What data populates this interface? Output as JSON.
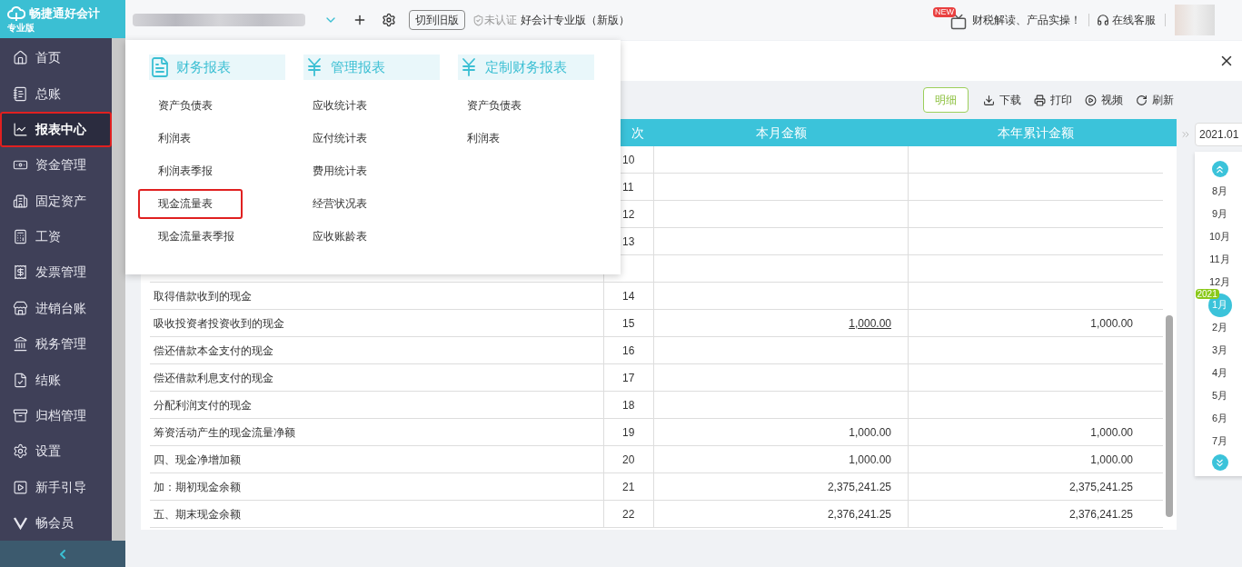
{
  "logo": {
    "name": "畅捷通好会计",
    "edition": "专业版"
  },
  "topbar": {
    "switch_button": "切到旧版",
    "cert_status": "未认证",
    "product": "好会计专业版（新版）",
    "promo_badge": "NEW",
    "promo": "财税解读、产品实操！",
    "support": "在线客服"
  },
  "sidebar": {
    "items": [
      {
        "label": "首页",
        "selected": false,
        "highlighted": false
      },
      {
        "label": "总账",
        "selected": false,
        "highlighted": false
      },
      {
        "label": "报表中心",
        "selected": true,
        "highlighted": true
      },
      {
        "label": "资金管理",
        "selected": false,
        "highlighted": false
      },
      {
        "label": "固定资产",
        "selected": false,
        "highlighted": false
      },
      {
        "label": "工资",
        "selected": false,
        "highlighted": false
      },
      {
        "label": "发票管理",
        "selected": false,
        "highlighted": false
      },
      {
        "label": "进销台账",
        "selected": false,
        "highlighted": false
      },
      {
        "label": "税务管理",
        "selected": false,
        "highlighted": false
      },
      {
        "label": "结账",
        "selected": false,
        "highlighted": false
      },
      {
        "label": "归档管理",
        "selected": false,
        "highlighted": false
      },
      {
        "label": "设置",
        "selected": false,
        "highlighted": false
      },
      {
        "label": "新手引导",
        "selected": false,
        "highlighted": false
      },
      {
        "label": "畅会员",
        "selected": false,
        "highlighted": false
      }
    ]
  },
  "menu": {
    "groups": [
      {
        "title": "财务报表",
        "items": [
          {
            "label": "资产负债表",
            "highlighted": false
          },
          {
            "label": "利润表",
            "highlighted": false
          },
          {
            "label": "利润表季报",
            "highlighted": false
          },
          {
            "label": "现金流量表",
            "highlighted": true
          },
          {
            "label": "现金流量表季报",
            "highlighted": false
          }
        ]
      },
      {
        "title": "管理报表",
        "items": [
          {
            "label": "应收统计表",
            "highlighted": false
          },
          {
            "label": "应付统计表",
            "highlighted": false
          },
          {
            "label": "费用统计表",
            "highlighted": false
          },
          {
            "label": "经营状况表",
            "highlighted": false
          },
          {
            "label": "应收账龄表",
            "highlighted": false
          }
        ]
      },
      {
        "title": "定制财务报表",
        "items": [
          {
            "label": "资产负债表",
            "highlighted": false
          },
          {
            "label": "利润表",
            "highlighted": false
          }
        ]
      }
    ]
  },
  "toolbar": [
    {
      "label": "明细",
      "kind": "primary"
    },
    {
      "label": "下载",
      "kind": "download"
    },
    {
      "label": "打印",
      "kind": "print"
    },
    {
      "label": "视频",
      "kind": "video"
    },
    {
      "label": "刷新",
      "kind": "refresh"
    }
  ],
  "table": {
    "columns": [
      "次",
      "本月金额",
      "本年累计金额"
    ],
    "rows": [
      {
        "line": "10"
      },
      {
        "line": "11"
      },
      {
        "line": "12"
      },
      {
        "line": "13"
      },
      {},
      {
        "name": "取得借款收到的现金",
        "line": "14"
      },
      {
        "name": "吸收投资者投资收到的现金",
        "line": "15",
        "month": "1,000.00",
        "year": "1,000.00",
        "month_link": true
      },
      {
        "name": "偿还借款本金支付的现金",
        "line": "16"
      },
      {
        "name": "偿还借款利息支付的现金",
        "line": "17"
      },
      {
        "name": "分配利润支付的现金",
        "line": "18"
      },
      {
        "name": "筹资活动产生的现金流量净额",
        "line": "19",
        "month": "1,000.00",
        "year": "1,000.00",
        "month_link": false
      },
      {
        "name": "四、现金净增加额",
        "line": "20",
        "month": "1,000.00",
        "year": "1,000.00",
        "month_link": false
      },
      {
        "name": "加：期初现金余额",
        "line": "21",
        "month": "2,375,241.25",
        "year": "2,375,241.25",
        "month_link": false
      },
      {
        "name": "五、期末现金余额",
        "line": "22",
        "month": "2,376,241.25",
        "year": "2,376,241.25",
        "month_link": false
      }
    ]
  },
  "period": {
    "value": "2021.01",
    "months": [
      {
        "label": "8月",
        "selected": false
      },
      {
        "label": "9月",
        "selected": false
      },
      {
        "label": "10月",
        "selected": false
      },
      {
        "label": "11月",
        "selected": false
      },
      {
        "label": "12月",
        "selected": false
      },
      {
        "label": "1月",
        "selected": true,
        "badge": "2021"
      },
      {
        "label": "2月",
        "selected": false
      },
      {
        "label": "3月",
        "selected": false
      },
      {
        "label": "4月",
        "selected": false
      },
      {
        "label": "5月",
        "selected": false
      },
      {
        "label": "6月",
        "selected": false
      },
      {
        "label": "7月",
        "selected": false
      }
    ]
  }
}
